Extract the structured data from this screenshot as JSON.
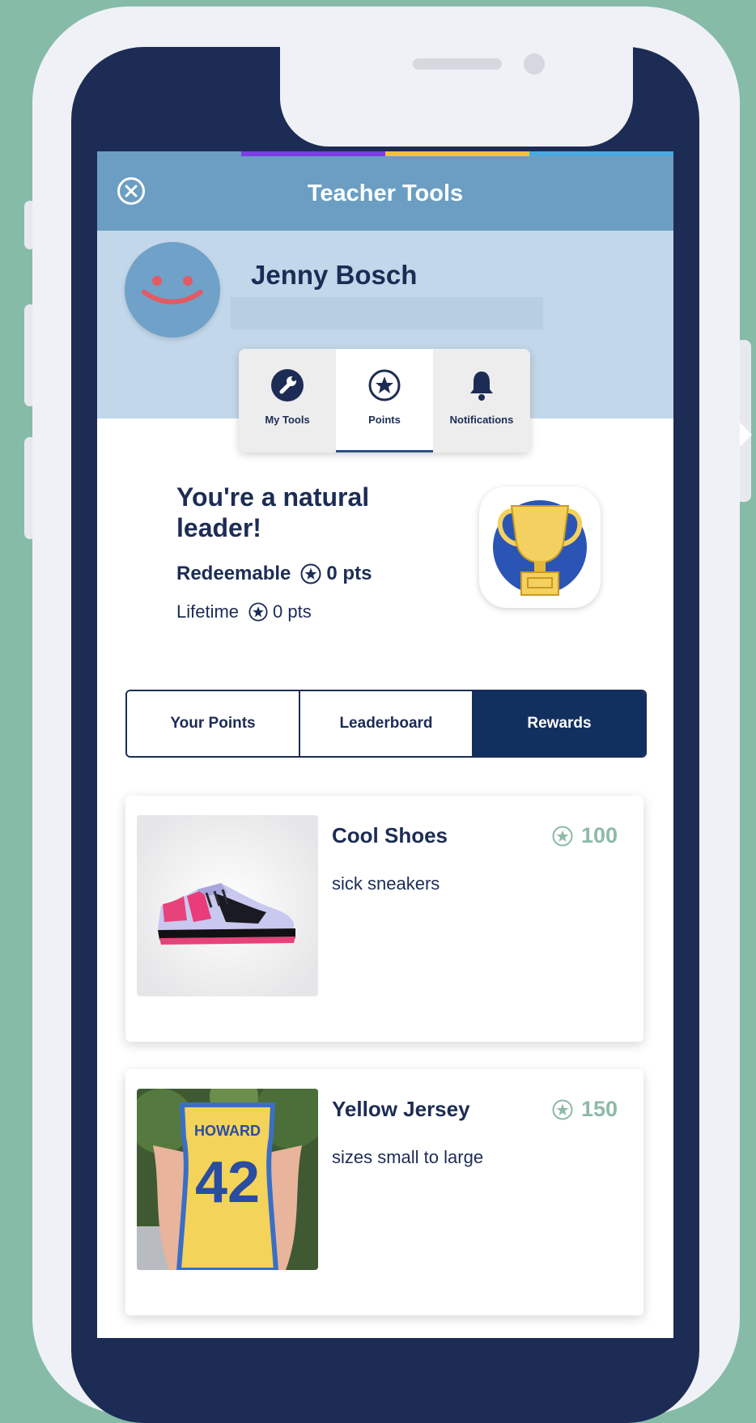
{
  "header": {
    "title": "Teacher Tools"
  },
  "profile": {
    "name": "Jenny Bosch"
  },
  "mini_tabs": [
    {
      "label": "My Tools",
      "icon": "wrench-icon",
      "active": false
    },
    {
      "label": "Points",
      "icon": "star-icon",
      "active": true
    },
    {
      "label": "Notifications",
      "icon": "bell-icon",
      "active": false
    }
  ],
  "points": {
    "headline": "You're a natural leader!",
    "redeemable_label": "Redeemable",
    "redeemable_value": "0 pts",
    "lifetime_label": "Lifetime",
    "lifetime_value": "0 pts",
    "badge_icon": "trophy-icon"
  },
  "segments": [
    {
      "label": "Your Points",
      "active": false
    },
    {
      "label": "Leaderboard",
      "active": false
    },
    {
      "label": "Rewards",
      "active": true
    }
  ],
  "rewards": [
    {
      "title": "Cool Shoes",
      "description": "sick sneakers",
      "cost": "100",
      "image": "sneaker-image"
    },
    {
      "title": "Yellow Jersey",
      "description": "sizes small to large",
      "cost": "150",
      "image": "jersey-image",
      "jersey_name": "HOWARD",
      "jersey_number": "42"
    }
  ],
  "colors": {
    "background": "#86bba8",
    "navy": "#1c2c55",
    "header": "#6b9ec2",
    "profile_band": "#c2d7ea",
    "cost_green": "#8dbaa6",
    "stripe_purple": "#7b3fe4",
    "stripe_yellow": "#f0c43a",
    "stripe_blue": "#4aa9e0"
  }
}
